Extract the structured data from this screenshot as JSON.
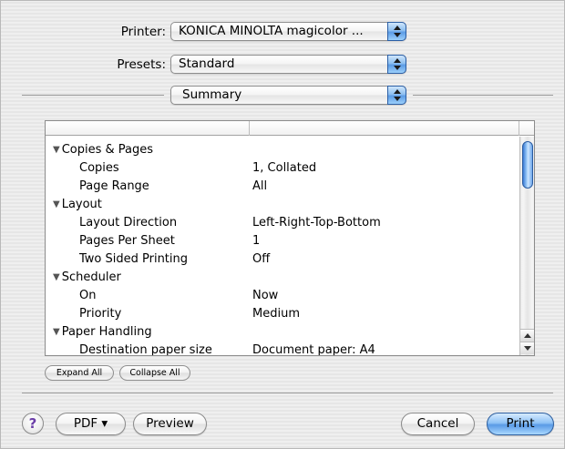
{
  "printer": {
    "label": "Printer:",
    "value": "KONICA MINOLTA magicolor ..."
  },
  "presets": {
    "label": "Presets:",
    "value": "Standard"
  },
  "panel": {
    "value": "Summary"
  },
  "summary_rows": [
    {
      "type": "group",
      "label": "Copies & Pages"
    },
    {
      "type": "item",
      "label": "Copies",
      "value": "1, Collated"
    },
    {
      "type": "item",
      "label": "Page Range",
      "value": "All"
    },
    {
      "type": "group",
      "label": "Layout"
    },
    {
      "type": "item",
      "label": "Layout Direction",
      "value": "Left-Right-Top-Bottom"
    },
    {
      "type": "item",
      "label": "Pages Per Sheet",
      "value": "1"
    },
    {
      "type": "item",
      "label": "Two Sided Printing",
      "value": "Off"
    },
    {
      "type": "group",
      "label": "Scheduler"
    },
    {
      "type": "item",
      "label": "On",
      "value": "Now"
    },
    {
      "type": "item",
      "label": "Priority",
      "value": "Medium"
    },
    {
      "type": "group",
      "label": "Paper Handling"
    },
    {
      "type": "item",
      "label": "Destination paper size",
      "value": "Document paper: A4"
    }
  ],
  "buttons": {
    "expand_all": "Expand All",
    "collapse_all": "Collapse All",
    "help": "?",
    "pdf": "PDF ▾",
    "preview": "Preview",
    "cancel": "Cancel",
    "print": "Print"
  },
  "icons": {
    "group_triangle": "disclosure-triangle-down",
    "popup": "up-down-arrows",
    "help": "question-mark"
  },
  "colors": {
    "accent": "#5a9ae6",
    "help_glyph": "#6b3ea8"
  }
}
